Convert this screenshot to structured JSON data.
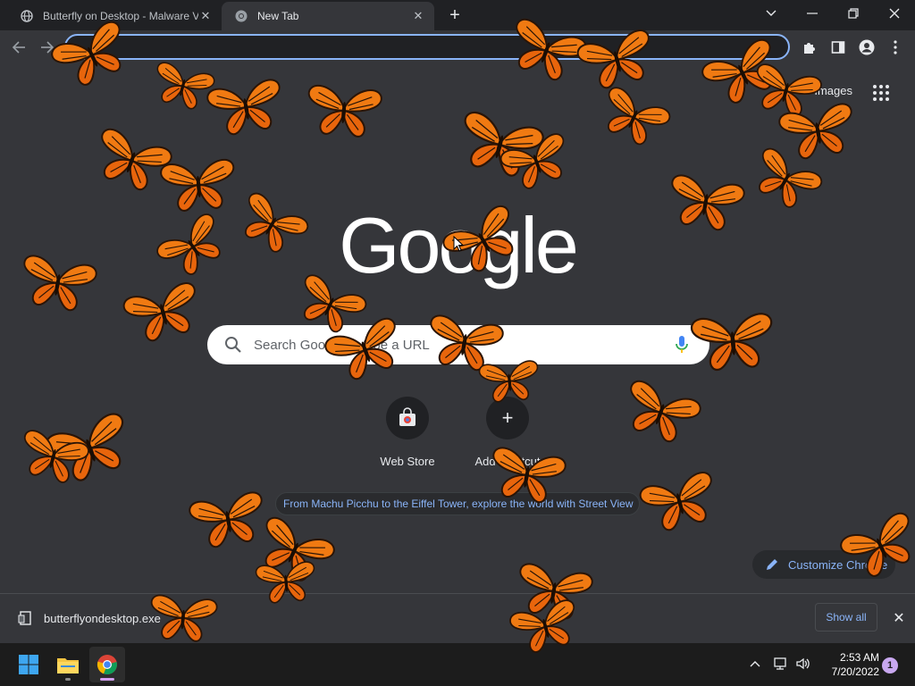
{
  "browser": {
    "tabs": [
      {
        "title": "Butterfly on Desktop - Malware V",
        "favicon": "globe-icon",
        "active": false
      },
      {
        "title": "New Tab",
        "favicon": "chrome-icon",
        "active": true
      }
    ],
    "new_tab_symbol": "+",
    "window_controls": [
      "chevron-down-icon",
      "minimize-icon",
      "restore-icon",
      "close-icon"
    ]
  },
  "toolbar": {
    "omnibox_value": "",
    "icons": [
      "extensions-icon",
      "side-panel-icon",
      "profile-icon",
      "menu-icon"
    ]
  },
  "ntp": {
    "images_link": "Images",
    "logo": "Google",
    "search_placeholder": "Search Google or type a URL",
    "shortcuts": [
      {
        "label": "Web Store",
        "icon": "web-store-icon"
      },
      {
        "label": "Add shortcut",
        "icon": "plus-icon"
      }
    ],
    "promo": "From Machu Picchu to the Eiffel Tower, explore the world with Street View",
    "customize_label": "Customize Chrome"
  },
  "download_shelf": {
    "filename": "butterflyondesktop.exe",
    "show_all": "Show all"
  },
  "taskbar": {
    "apps": [
      "windows-start-icon",
      "file-explorer-icon",
      "chrome-icon"
    ],
    "time": "2:53 AM",
    "date": "7/20/2022",
    "notification_count": "1"
  },
  "colors": {
    "accent": "#8ab4f8",
    "butterfly_orange": "#f07a12",
    "background": "#35363a"
  }
}
